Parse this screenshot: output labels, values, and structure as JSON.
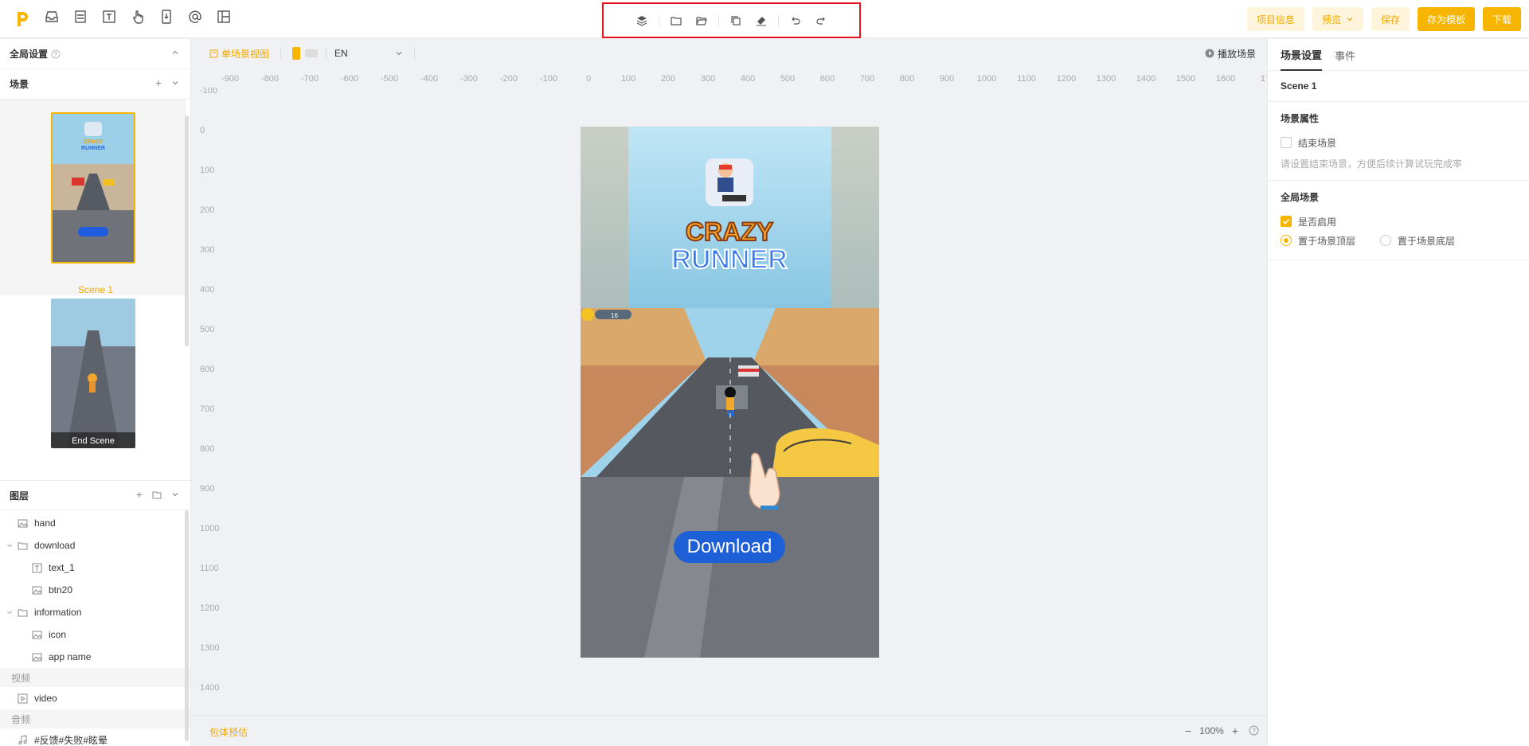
{
  "toolbar": {
    "right_buttons": {
      "project_info": "项目信息",
      "preview": "预览",
      "save": "保存",
      "save_template": "存为模板",
      "download": "下载"
    }
  },
  "left_panel": {
    "global_settings": "全局设置",
    "scenes_title": "场景",
    "scenes": [
      {
        "label": "Scene 1",
        "selected": true
      },
      {
        "label": "End Scene",
        "selected": false
      }
    ],
    "layers_title": "图层",
    "layers": [
      {
        "name": "hand",
        "type": "image",
        "indent": 0
      },
      {
        "name": "download",
        "type": "folder",
        "indent": 0
      },
      {
        "name": "text_1",
        "type": "text",
        "indent": 1
      },
      {
        "name": "btn20",
        "type": "image",
        "indent": 1
      },
      {
        "name": "information",
        "type": "folder",
        "indent": 0
      },
      {
        "name": "icon",
        "type": "image",
        "indent": 1
      },
      {
        "name": "app name",
        "type": "image",
        "indent": 1
      }
    ],
    "video_title": "视频",
    "video_item": "video",
    "audio_title": "音频",
    "audio_item": "#反馈#失败#眩晕"
  },
  "canvas": {
    "view_mode": "单场景视图",
    "language": "EN",
    "play_scene": "播放场景",
    "ruler_x": [
      "-900",
      "-800",
      "-700",
      "-600",
      "-500",
      "-400",
      "-300",
      "-200",
      "-100",
      "0",
      "100",
      "200",
      "300",
      "400",
      "500",
      "600",
      "700",
      "800",
      "900",
      "1000",
      "1100",
      "1200",
      "1300",
      "1400",
      "1500",
      "1600",
      "17"
    ],
    "ruler_y": [
      "-100",
      "0",
      "100",
      "200",
      "300",
      "400",
      "500",
      "600",
      "700",
      "800",
      "900",
      "1000",
      "1100",
      "1200",
      "1300",
      "1400"
    ],
    "game": {
      "title_line1": "CRAZY",
      "title_line2": "RUNNER",
      "score": "16",
      "download_label": "Download"
    },
    "package_estimate": "包体预估",
    "zoom": "100%"
  },
  "right_panel": {
    "tab_scene": "场景设置",
    "tab_events": "事件",
    "scene_name": "Scene 1",
    "scene_props_title": "场景属性",
    "end_scene_label": "结束场景",
    "end_scene_checked": false,
    "end_scene_hint": "请设置结束场景，方便后续计算试玩完成率",
    "global_scene_title": "全局场景",
    "enabled_label": "是否启用",
    "enabled_checked": true,
    "top_label": "置于场景顶层",
    "bottom_label": "置于场景底层",
    "placement": "top"
  }
}
